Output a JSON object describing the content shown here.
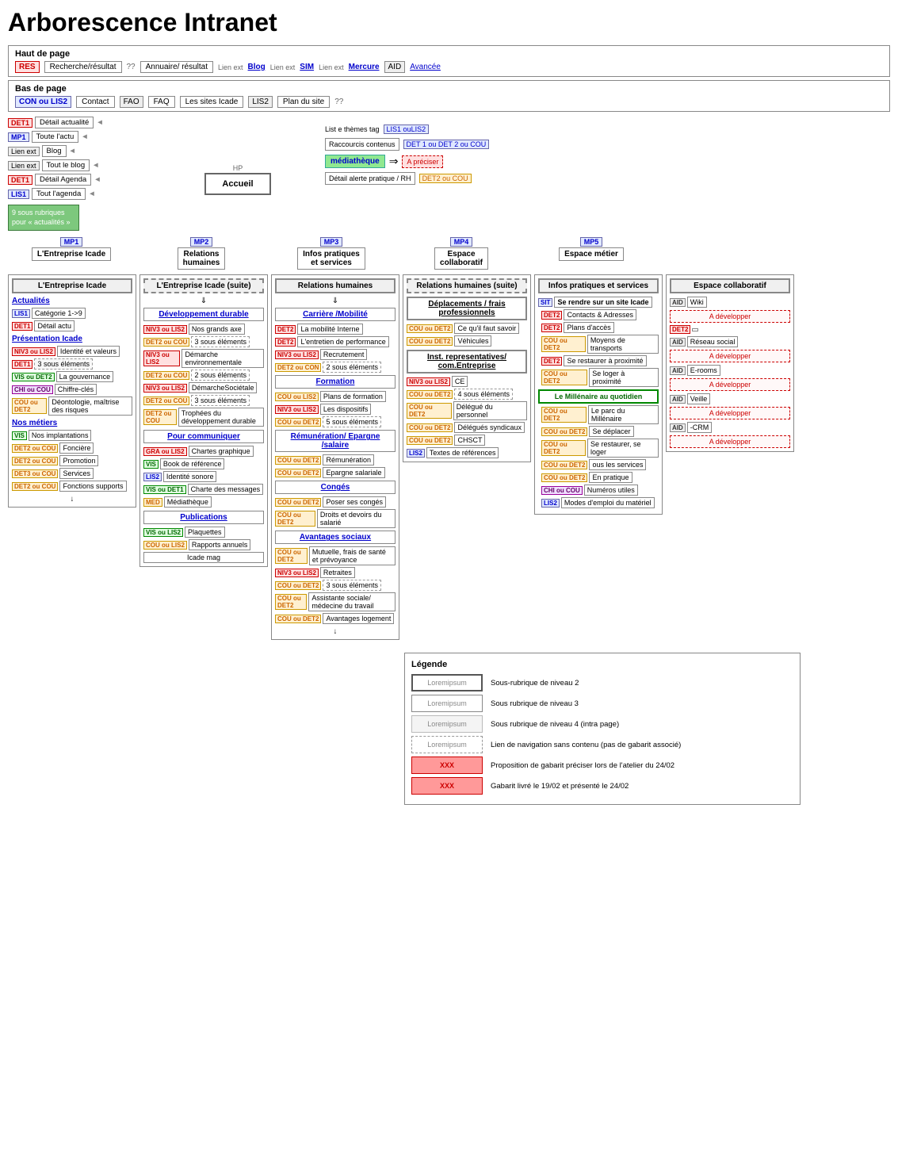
{
  "title": "Arborescence Intranet",
  "header": {
    "haut_label": "Haut de page",
    "bas_label": "Bas de page",
    "haut_items": [
      {
        "tag": "RES",
        "tag_class": "t-red",
        "label": "Recherche/résultat",
        "sep": "??"
      },
      {
        "tag": "",
        "label": "Annuaire/ résultat"
      },
      {
        "tag": "Lien ext",
        "tag_class": "t-gray",
        "label": "Blog",
        "label_class": "link-blue"
      },
      {
        "tag": "Lien ext",
        "tag_class": "t-gray",
        "label": "SIM",
        "label_class": "link-blue"
      },
      {
        "tag": "Lien ext",
        "tag_class": "t-gray",
        "label": "Mercure",
        "label_class": "link-blue"
      },
      {
        "tag": "AID",
        "tag_class": "t-gray",
        "label": ""
      }
    ],
    "avancee": "Avancée",
    "bas_items": [
      {
        "tag": "CON ou LIS2",
        "tag_class": "t-blue",
        "label": "Contact"
      },
      {
        "label": "FAQ",
        "tag": "FAO"
      },
      {
        "label": "Les sites Icade",
        "tag": "LIS2"
      },
      {
        "label": "Plan du site"
      },
      {
        "label": "??"
      }
    ]
  },
  "hp_label": "HP",
  "accueil_label": "Accueil",
  "left_menu": {
    "items": [
      {
        "badge": "DET1",
        "badge_class": "t-red",
        "label": "Détail actualité"
      },
      {
        "badge": "MP1",
        "badge_class": "t-blue",
        "label": "Toute l'actu"
      },
      {
        "badge": "Lien ext",
        "badge_class": "t-gray",
        "label": "Blog"
      },
      {
        "badge": "Lien ext",
        "badge_class": "t-gray",
        "label": "Tout le blog"
      },
      {
        "badge": "DET1",
        "badge_class": "t-red",
        "label": "Détail Agenda"
      },
      {
        "badge": "LIS1",
        "badge_class": "t-blue",
        "label": "Tout l'agenda"
      }
    ],
    "green_box": "9 sous rubriques pour « actualités »"
  },
  "right_tags": {
    "list_themes": "List e thèmes tag",
    "list_badge": "LIS1 ouLIS2",
    "raccourcis": "Raccourcis contenus",
    "raccourcis_badge": "DET 1  ou DET 2 ou COU",
    "mediatheque": "médiathèque",
    "a_preciser": "A préciser",
    "detail_alerte": "Détail alerte pratique / RH",
    "detail_alerte_badge": "DET2 ou COU"
  },
  "mp_nodes": [
    {
      "id": "MP1",
      "label": "L'Entreprise Icade"
    },
    {
      "id": "MP2",
      "label": "Relations humaines"
    },
    {
      "id": "MP3",
      "label": "Infos pratiques et services"
    },
    {
      "id": "MP4",
      "label": "Espace collaboratif"
    },
    {
      "id": "MP5",
      "label": "Espace métier"
    }
  ],
  "col1": {
    "title": "L'Entreprise Icade",
    "sections": [
      {
        "header": "Actualités",
        "items": [
          {
            "badge": "LIS1",
            "bc": "t-blue",
            "label": "Catégorie 1->9"
          },
          {
            "badge": "DET1",
            "bc": "t-red",
            "label": "Détail actu"
          },
          {
            "header2": "Présentation Icade"
          },
          {
            "badge": "NIV3 ou LIS2",
            "bc": "t-red",
            "label": "Identité et valeurs"
          },
          {
            "badge": "DET1",
            "bc": "t-red",
            "sub": "3 sous éléments"
          },
          {
            "badge": "VIS ou DET2",
            "bc": "t-green",
            "label": "La gouvernance"
          },
          {
            "badge": "CHI ou COU",
            "bc": "t-purple",
            "label": "Chiffre-clés"
          },
          {
            "badge": "COU ou DET2",
            "bc": "t-orange",
            "label": "Déontologie, maîtrise des risques"
          }
        ]
      },
      {
        "header": "Nos métiers",
        "items": [
          {
            "badge": "VIS",
            "bc": "t-green",
            "label": "Nos implantations"
          },
          {
            "badge": "DET2 ou COU",
            "bc": "t-orange",
            "label": "Foncière"
          },
          {
            "badge": "DET2 ou COU",
            "bc": "t-orange",
            "label": "Promotion"
          },
          {
            "badge": "DET3 ou COU",
            "bc": "t-orange",
            "label": "Services"
          },
          {
            "badge": "DET2 ou COU",
            "bc": "t-orange",
            "label": "Fonctions supports"
          }
        ]
      }
    ]
  },
  "col2": {
    "title": "L'Entreprise Icade (suite)",
    "sections": [
      {
        "header": "Développement durable",
        "items": [
          {
            "badge": "NIV3 ou LIS2",
            "bc": "t-red",
            "label": "Nos grands axe"
          },
          {
            "badge": "DET2 ou COU",
            "bc": "t-orange",
            "sub": "3 sous éléments"
          },
          {
            "badge": "NIV3 ou LIS2",
            "bc": "t-red",
            "label": "Démarche environnementale"
          },
          {
            "badge": "DET2 ou COU",
            "bc": "t-orange",
            "sub": "2 sous éléments"
          },
          {
            "badge": "NIV3 ou LIS2",
            "bc": "t-red",
            "label": "DémarcheSociétale"
          },
          {
            "badge": "DET2 ou COU",
            "bc": "t-orange",
            "sub": "3 sous éléments"
          },
          {
            "badge": "DET2 ou COU",
            "bc": "t-orange",
            "label": "Trophées du développement durable"
          }
        ]
      },
      {
        "header": "Pour communiquer",
        "items": [
          {
            "badge": "GRA ou LIS2",
            "bc": "t-red",
            "label": "Chartes graphique"
          },
          {
            "badge": "VIS",
            "bc": "t-green",
            "label": "Book de référence"
          },
          {
            "badge": "LIS2",
            "bc": "t-blue",
            "label": "Identité sonore"
          },
          {
            "badge": "VIS ou DET1",
            "bc": "t-green",
            "label": "Charte des messages"
          },
          {
            "badge": "MED",
            "bc": "t-orange",
            "label": "Médiathèque"
          }
        ]
      },
      {
        "header": "Publications",
        "items": [
          {
            "badge": "VIS ou LIS2",
            "bc": "t-green",
            "label": "Plaquettes"
          },
          {
            "badge": "COU ou LIS2",
            "bc": "t-orange",
            "label": "Rapports annuels"
          },
          {
            "label": "Icade mag"
          }
        ]
      }
    ]
  },
  "col3": {
    "title": "Relations humaines",
    "sections": [
      {
        "header": "Carrière /Mobilité",
        "items": [
          {
            "badge": "DET2",
            "bc": "t-red",
            "label": "La mobilité Interne"
          },
          {
            "badge": "DET2",
            "bc": "t-red",
            "label": "L'entretien de performance"
          },
          {
            "badge": "NIV3 ou LIS2",
            "bc": "t-red",
            "label": "Recrutement"
          },
          {
            "badge": "DET2 ou CON",
            "bc": "t-orange",
            "sub": "2 sous éléments"
          }
        ]
      },
      {
        "header": "Formation",
        "items": [
          {
            "badge": "COU ou LIS2",
            "bc": "t-orange",
            "label": "Plans de formation"
          },
          {
            "badge": "NIV3 ou LIS2",
            "bc": "t-red",
            "label": "Les dispositifs"
          },
          {
            "badge": "COU ou DET2",
            "bc": "t-orange",
            "sub": "5 sous éléments"
          }
        ]
      },
      {
        "header": "Rémunération/ Epargne /salaire",
        "items": [
          {
            "badge": "COU ou DET2",
            "bc": "t-orange",
            "label": "Rémunération"
          },
          {
            "badge": "COU ou DET2",
            "bc": "t-orange",
            "label": "Epargne salariale"
          }
        ]
      },
      {
        "header": "Congés",
        "items": [
          {
            "badge": "COU ou DET2",
            "bc": "t-orange",
            "label": "Poser ses congés"
          },
          {
            "badge": "COU ou DET2",
            "bc": "t-orange",
            "label": "Droits et devoirs du salarié"
          }
        ]
      },
      {
        "header": "Avantages sociaux",
        "items": [
          {
            "badge": "COU ou DET2",
            "bc": "t-orange",
            "label": "Mutuelle, frais de santé et prévoyance"
          },
          {
            "badge": "NIV3 ou LIS2",
            "bc": "t-red",
            "label": "Retraites"
          },
          {
            "badge": "COU ou DET2",
            "bc": "t-orange",
            "sub": "3 sous éléments"
          },
          {
            "badge": "COU ou DET2",
            "bc": "t-orange",
            "label": "Assistante sociale/ médecine du travail"
          },
          {
            "badge": "COU ou DET2",
            "bc": "t-orange",
            "label": "Avantages logement"
          }
        ]
      }
    ]
  },
  "col4": {
    "title": "Relations humaines (suite)",
    "sections": [
      {
        "header": "Déplacements / frais professionnels",
        "items": [
          {
            "badge": "COU ou DET2",
            "bc": "t-orange",
            "label": "Ce qu'il faut savoir"
          },
          {
            "badge": "COU ou DET2",
            "bc": "t-orange",
            "label": "Véhicules"
          }
        ]
      },
      {
        "header": "Inst. representatives/ com.Entreprise",
        "items": [
          {
            "badge": "NIV3 ou LIS2",
            "bc": "t-red",
            "label": "CE"
          },
          {
            "badge": "COU ou DET2",
            "bc": "t-orange",
            "sub": "4 sous éléments"
          },
          {
            "badge": "COU ou DET2",
            "bc": "t-orange",
            "label": "Délégué du personnel"
          },
          {
            "badge": "COU ou DET2",
            "bc": "t-orange",
            "label": "Délégués syndicaux"
          },
          {
            "badge": "COU ou DET2",
            "bc": "t-orange",
            "label": "CHSCT"
          },
          {
            "badge": "LIS2",
            "bc": "t-blue",
            "label": "Textes de références"
          }
        ]
      }
    ]
  },
  "col5": {
    "title": "Infos pratiques et services",
    "sections": [
      {
        "header": "Se rendre sur un site Icade",
        "tag": "SIT",
        "items": [
          {
            "badge": "DET2",
            "bc": "t-red",
            "label": "Contacts & Adresses"
          },
          {
            "badge": "DET2",
            "bc": "t-red",
            "label": "Plans d'accès"
          },
          {
            "badge": "COU ou DET2",
            "bc": "t-orange",
            "label": "Moyens de transports"
          },
          {
            "badge": "DET2",
            "bc": "t-red",
            "label": "Se restaurer à proximité"
          },
          {
            "badge": "COU ou DET2",
            "bc": "t-orange",
            "label": "Se loger à proximité"
          },
          {
            "header2": "Le Millénaire au quotidien"
          },
          {
            "badge": "COU ou DET2",
            "bc": "t-orange",
            "label": "Le parc du Millénaire"
          },
          {
            "badge": "COU ou DET2",
            "bc": "t-orange",
            "label": "Se déplacer"
          },
          {
            "badge": "COU ou DET2",
            "bc": "t-orange",
            "label": "Se restaurer, se loger"
          },
          {
            "badge": "COU ou DET2",
            "bc": "t-orange",
            "label": "ous les services"
          },
          {
            "badge": "COU ou DET2",
            "bc": "t-orange",
            "label": "En pratique"
          },
          {
            "badge": "CHI ou COU",
            "bc": "t-purple",
            "label": "Numéros utiles"
          },
          {
            "badge": "LIS2",
            "bc": "t-blue",
            "label": "Modes d'emploi du matériel"
          }
        ]
      }
    ]
  },
  "col6": {
    "title": "Espace collaboratif",
    "sections": [
      {
        "badge": "AID",
        "bc": "t-gray",
        "label": "Wiki"
      },
      {
        "develop": "A développer"
      },
      {
        "badge": "DET2",
        "bc": "t-red",
        "label": ""
      },
      {
        "badge": "AID",
        "bc": "t-gray",
        "label": "Réseau social"
      },
      {
        "develop": "A développer"
      },
      {
        "badge": "AID",
        "bc": "t-gray",
        "label": "E-rooms"
      },
      {
        "develop": "A développer"
      },
      {
        "badge": "AID",
        "bc": "t-gray",
        "label": "Veille"
      },
      {
        "develop": "A développer"
      },
      {
        "badge": "AID",
        "bc": "t-gray",
        "label": "-CRM"
      },
      {
        "develop": "A développer"
      }
    ]
  },
  "legend": {
    "title": "Légende",
    "items": [
      {
        "sample": "Loremipsum",
        "sample_class": "solid",
        "desc": "Sous-rubrique de niveau 2"
      },
      {
        "sample": "Loremipsum",
        "sample_class": "solid",
        "desc": "Sous rubrique de niveau 3"
      },
      {
        "sample": "Loremipsum",
        "sample_class": "inset",
        "desc": "Sous rubrique de niveau 4 (intra page)"
      },
      {
        "sample": "Loremipsum",
        "sample_class": "dashed",
        "desc": "Lien de navigation sans contenu (pas de gabarit associé)"
      },
      {
        "sample": "XXX",
        "sample_class": "xxx",
        "desc": "Proposition de gabarit  préciser lors de l'atelier du 24/02"
      },
      {
        "sample": "XXX",
        "sample_class": "xxx2",
        "desc": "Gabarit livré le 19/02 et présenté le 24/02"
      }
    ]
  }
}
